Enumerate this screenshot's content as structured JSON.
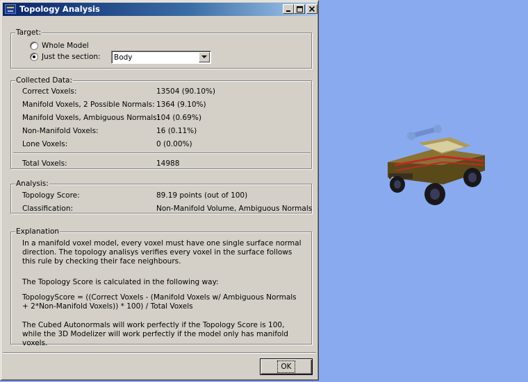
{
  "window": {
    "title": "Topology Analysis",
    "ok_label": "OK"
  },
  "target": {
    "legend": "Target:",
    "option_whole": "Whole Model",
    "option_section": "Just the section:",
    "selected": "section",
    "section_value": "Body"
  },
  "collected": {
    "legend": "Collected Data:",
    "rows": [
      {
        "label": "Correct Voxels:",
        "value": "13504 (90.10%)"
      },
      {
        "label": "Manifold Voxels, 2 Possible Normals:",
        "value": "1364 (9.10%)"
      },
      {
        "label": "Manifold Voxels, Ambiguous Normals:",
        "value": "104 (0.69%)"
      },
      {
        "label": "Non-Manifold Voxels:",
        "value": "16 (0.11%)"
      },
      {
        "label": "Lone Voxels:",
        "value": "0 (0.00%)"
      }
    ],
    "total_label": "Total Voxels:",
    "total_value": "14988"
  },
  "analysis": {
    "legend": "Analysis:",
    "score_label": "Topology Score:",
    "score_value": "89.19 points (out of 100)",
    "class_label": "Classification:",
    "class_value": "Non-Manifold Volume, Ambiguous Normals"
  },
  "explanation": {
    "legend": "Explanation",
    "p1": "In a manifold voxel model, every voxel must have one single surface normal direction. The topology analisys verifies every voxel in the surface follows this rule by checking their face neighbours.",
    "p2": "The Topology Score is calculated in the following way:",
    "p3": "TopologyScore =  ((Correct Voxels  - (Manifold Voxels w/ Ambiguous Normals + 2*Non-Manifold Voxels)) * 100) / Total Voxels",
    "p4": "The Cubed Autonormals will work perfectly if the Topology Score is 100, while the 3D Modelizer will work perfectly if the model only has manifold voxels."
  },
  "colors": {
    "desktop": "#8aaaf0",
    "title_start": "#0a246a",
    "title_end": "#a6caf0",
    "face": "#d4d0c8"
  },
  "icons": [
    "app-icon",
    "minimize-icon",
    "maximize-icon",
    "close-icon",
    "dropdown-arrow-icon"
  ]
}
